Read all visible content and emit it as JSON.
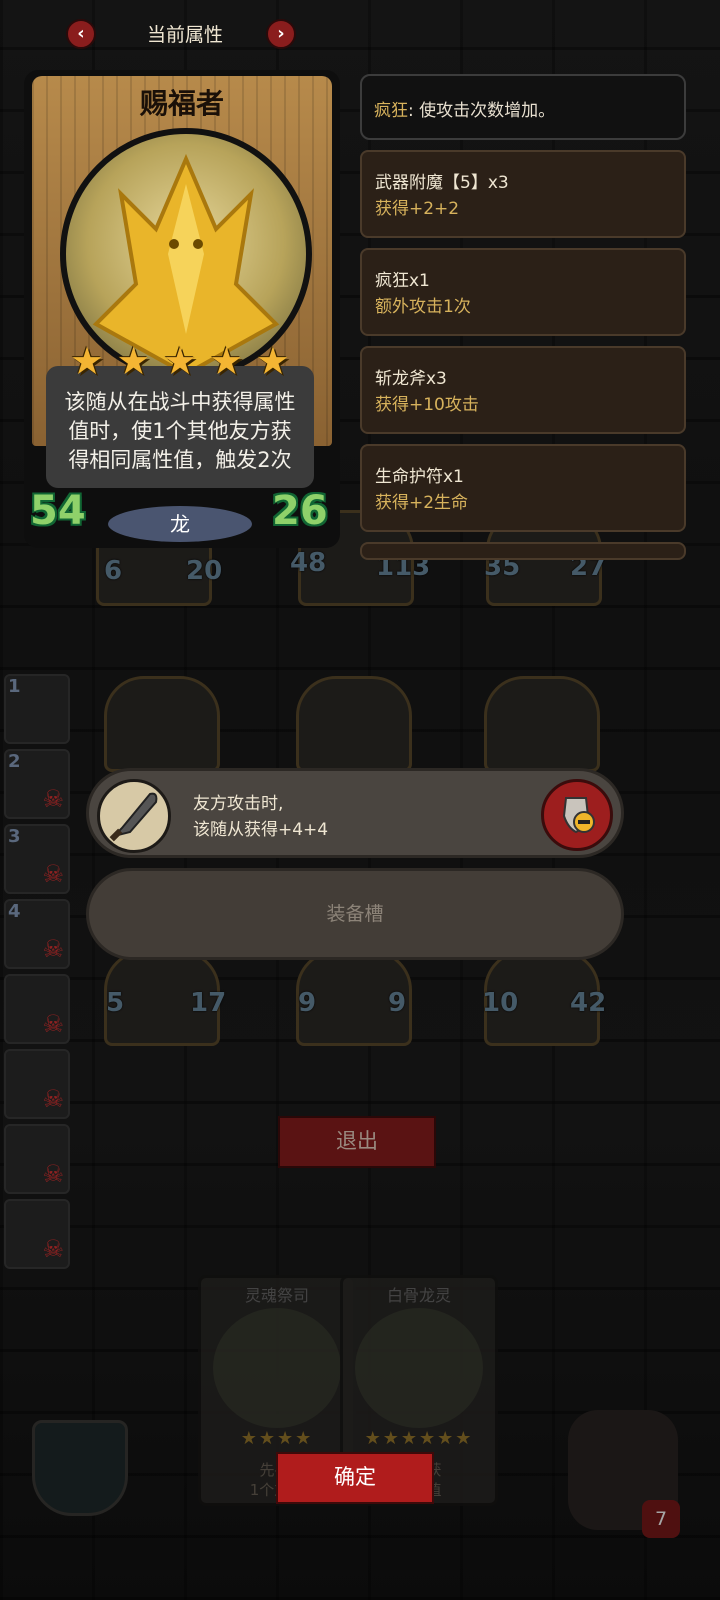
{
  "header": {
    "title": "当前属性",
    "prev_icon": "chevron-left-icon",
    "next_icon": "chevron-right-icon",
    "prev_glyph": "‹",
    "next_glyph": "›"
  },
  "card": {
    "name": "赐福者",
    "stars": 5,
    "description": [
      "该随从在战斗中获得属性",
      "值时，使1个其他友方获",
      "得相同属性值，触发2次"
    ],
    "attack": "54",
    "health": "26",
    "tribe": "龙"
  },
  "effects": {
    "keyword": "疯狂",
    "keyword_desc": ": 使攻击次数增加。",
    "items": [
      {
        "title": "武器附魔【5】x3",
        "sub": "获得+2+2"
      },
      {
        "title": "疯狂x1",
        "sub": "额外攻击1次"
      },
      {
        "title": "斩龙斧x3",
        "sub": "获得+10攻击"
      },
      {
        "title": "生命护符x1",
        "sub": "获得+2生命"
      }
    ]
  },
  "board": {
    "top_row_stats": [
      [
        "6",
        "20"
      ],
      [
        "48",
        "113"
      ],
      [
        "35",
        "27"
      ]
    ],
    "bottom_row_stats": [
      [
        "5",
        "17"
      ],
      [
        "9",
        "9"
      ],
      [
        "10",
        "42"
      ]
    ]
  },
  "bench": {
    "slots": [
      "1",
      "2",
      "3",
      "4",
      "",
      "",
      "",
      ""
    ]
  },
  "equipment": {
    "icon": "scimitar-icon",
    "line1": "友方攻击时,",
    "line2": "该随从获得+4+4",
    "remove_icon": "shield-minus-icon",
    "slot_label": "装备槽"
  },
  "buttons": {
    "exit": "退出",
    "confirm": "确定"
  },
  "bottom_cards": [
    {
      "name": "灵魂祭司",
      "text1": "先手:",
      "text2": "1个友方"
    },
    {
      "name": "白骨龙灵",
      "text1": "友方获",
      "text2": "属性值"
    }
  ],
  "corner_badge": "7",
  "colors": {
    "accent_gold": "#d7b25c",
    "stat_green": "#8fd16a",
    "button_red": "#b01c1c"
  }
}
